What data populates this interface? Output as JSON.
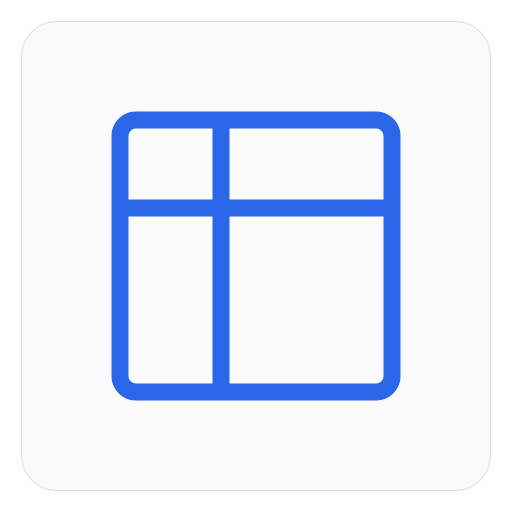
{
  "icon": {
    "name": "table-layout-icon",
    "stroke_color": "#2a66e8",
    "tile_background": "#fafafa",
    "tile_border": "#dcdcd8"
  }
}
